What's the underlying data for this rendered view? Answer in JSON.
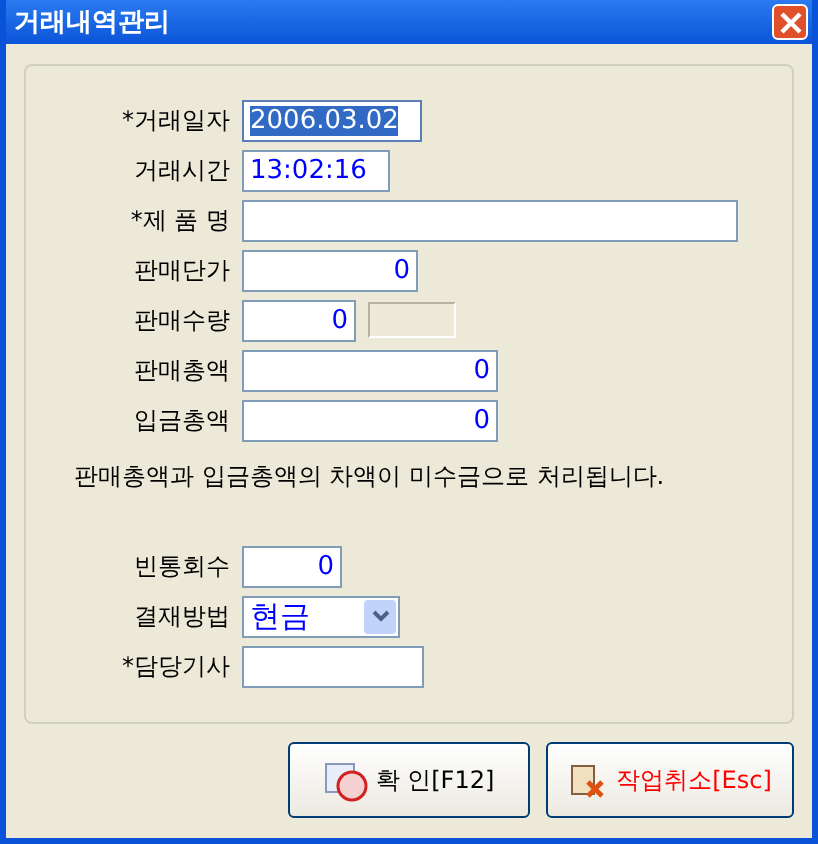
{
  "window": {
    "title": "거래내역관리"
  },
  "form": [
    {
      "kind": "text",
      "label": "*거래일자",
      "value": "2006.03.02",
      "highlighted": true
    },
    {
      "kind": "text",
      "label": "거래시간",
      "value": "13:02:16",
      "highlighted": false
    },
    {
      "kind": "text",
      "label": "*제 품 명"
    },
    {
      "kind": "number",
      "label": "판매단가",
      "value": "0",
      "highlighted": false
    },
    {
      "kind": "number",
      "label": "판매수량",
      "value": "0",
      "highlighted": false,
      "extra_field": {
        "disabled": true
      }
    },
    {
      "kind": "number",
      "label": "판매총액",
      "value": "0",
      "highlighted": false
    },
    {
      "kind": "number",
      "label": "입금총액",
      "value": "0",
      "highlighted": false
    },
    {
      "kind": "note",
      "text": "판매총액과 입금총액의 차액이 미수금으로 처리됩니다."
    },
    {
      "kind": "number",
      "label": "빈통회수",
      "value": "0",
      "highlighted": false
    },
    {
      "kind": "combo",
      "label": "결재방법",
      "value": "현금"
    },
    {
      "kind": "text",
      "label": "*담당기사"
    }
  ],
  "buttons": [
    {
      "kind": "stamp",
      "label": "확 인[F12]",
      "color": "#000000"
    },
    {
      "kind": "cancel",
      "label": "작업취소[Esc]",
      "color": "#ff0000"
    }
  ]
}
